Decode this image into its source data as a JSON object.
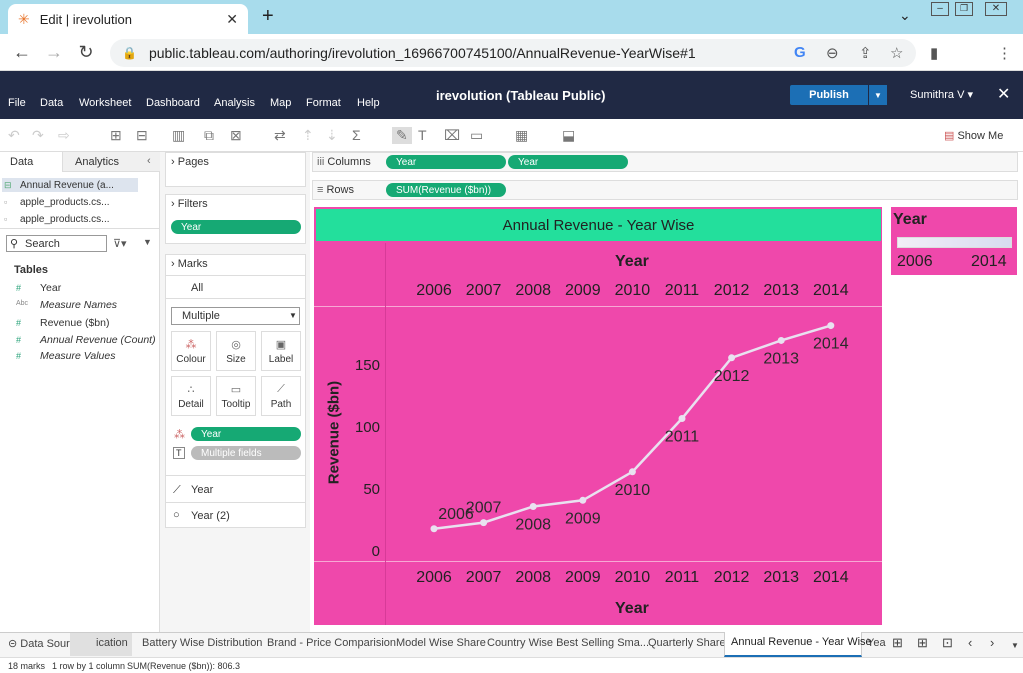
{
  "browser": {
    "tab_title": "Edit | irevolution",
    "url": "public.tableau.com/authoring/irevolution_16966700745100/AnnualRevenue-YearWise#1"
  },
  "app": {
    "menu": [
      "File",
      "Data",
      "Worksheet",
      "Dashboard",
      "Analysis",
      "Map",
      "Format",
      "Help"
    ],
    "title": "irevolution (Tableau Public)",
    "publish_label": "Publish",
    "user": "Sumithra V",
    "show_me": "Show Me"
  },
  "data_pane": {
    "tabs": [
      "Data",
      "Analytics"
    ],
    "sources": [
      "Annual Revenue (a...",
      "apple_products.cs...",
      "apple_products.cs..."
    ],
    "search_placeholder": "Search",
    "tables_label": "Tables",
    "fields": [
      {
        "icon": "#",
        "name": "Year",
        "italic": false
      },
      {
        "icon": "Abc",
        "name": "Measure Names",
        "italic": true
      },
      {
        "icon": "#",
        "name": "Revenue ($bn)",
        "italic": false
      },
      {
        "icon": "#",
        "name": "Annual Revenue (Count)",
        "italic": true
      },
      {
        "icon": "#",
        "name": "Measure Values",
        "italic": true
      }
    ]
  },
  "cards": {
    "pages": "Pages",
    "filters": "Filters",
    "filter_pill": "Year",
    "marks": "Marks",
    "marks_all": "All",
    "mark_type": "Multiple",
    "mark_buttons": [
      "Colour",
      "Size",
      "Label",
      "Detail",
      "Tooltip",
      "Path"
    ],
    "color_pill": "Year",
    "label_pill": "Multiple fields",
    "mark_rows": [
      "Year",
      "Year (2)"
    ]
  },
  "shelves": {
    "columns_label": "Columns",
    "columns_pills": [
      "Year",
      "Year"
    ],
    "rows_label": "Rows",
    "rows_pill": "SUM(Revenue ($bn))"
  },
  "viz": {
    "title": "Annual Revenue - Year Wise",
    "top_axis_title": "Year",
    "bottom_axis_title": "Year",
    "y_axis_title": "Revenue ($bn)"
  },
  "legend": {
    "title": "Year",
    "min": "2006",
    "max": "2014"
  },
  "chart_data": {
    "type": "line",
    "title": "Annual Revenue - Year Wise",
    "xlabel": "Year",
    "ylabel": "Revenue ($bn)",
    "x": [
      "2006",
      "2007",
      "2008",
      "2009",
      "2010",
      "2011",
      "2012",
      "2013",
      "2014"
    ],
    "series": [
      {
        "values": [
          19,
          24,
          37,
          42,
          65,
          108,
          157,
          171,
          183
        ]
      }
    ],
    "yticks": [
      "0",
      "50",
      "100",
      "150"
    ],
    "ylim": [
      -7,
      198
    ],
    "point_labels": [
      "2006",
      "2007",
      "2008",
      "2009",
      "2010",
      "2011",
      "2012",
      "2013",
      "2014"
    ],
    "grid": false,
    "line_color": "#e9e1f0"
  },
  "sheet_tabs": [
    "Data Source",
    "ication",
    "Battery Wise Distribution",
    "Brand - Price Comparision",
    "Model Wise Share",
    "Country Wise Best Selling Sma...",
    "Quarterly Share",
    "Annual Revenue - Year Wise",
    "Yea"
  ],
  "status": {
    "marks": "18 marks",
    "rows": "1 row by 1 column",
    "sum": "SUM(Revenue ($bn)): 806.3"
  }
}
